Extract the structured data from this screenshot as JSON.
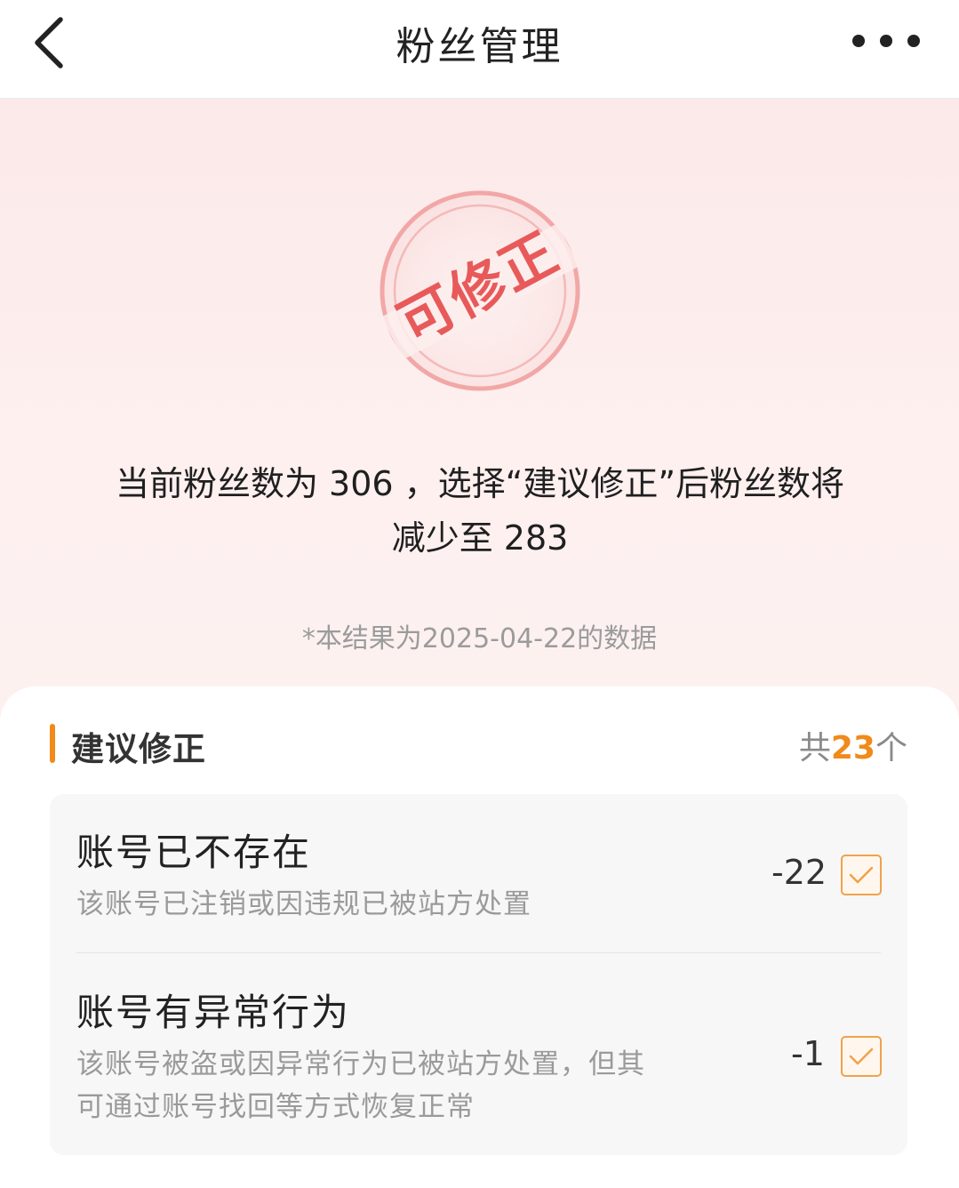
{
  "header": {
    "title": "粉丝管理",
    "back_icon": "chevron-left-icon",
    "more_icon": "more-horizontal-icon"
  },
  "hero": {
    "stamp_text": "可修正",
    "summary_line1": "当前粉丝数为 306 ，选择“建议修正”后粉丝数将",
    "summary_line2": "减少至 283",
    "date_note": "*本结果为2025-04-22的数据"
  },
  "section": {
    "title": "建议修正",
    "count_prefix": "共",
    "count_value": "23",
    "count_suffix": "个"
  },
  "items": [
    {
      "title": "账号已不存在",
      "desc_line1": "该账号已注销或因违规已被站方处置",
      "desc_line2": "",
      "delta": "-22",
      "checked": true
    },
    {
      "title": "账号有异常行为",
      "desc_line1": "该账号被盗或因异常行为已被站方处置，但其",
      "desc_line2": "可通过账号找回等方式恢复正常",
      "delta": "-1",
      "checked": true
    }
  ],
  "colors": {
    "accent": "#f08a1a",
    "stamp": "#e85a5a",
    "hero_bg": "#fce9e9",
    "checkbox_border": "#f0a24a"
  }
}
